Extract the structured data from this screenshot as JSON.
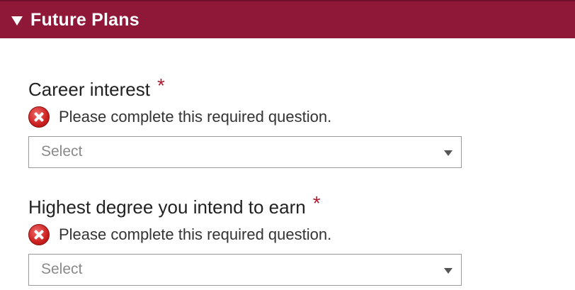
{
  "section": {
    "title": "Future Plans",
    "expanded_icon": "triangle-down-icon",
    "header_color": "#8f1838"
  },
  "questions": [
    {
      "label": "Career interest",
      "required_marker": "*",
      "error": {
        "icon": "error-x-icon",
        "message": "Please complete this required question."
      },
      "select": {
        "value": "Select",
        "icon": "caret-down-icon"
      }
    },
    {
      "label": "Highest degree you intend to earn",
      "required_marker": "*",
      "error": {
        "icon": "error-x-icon",
        "message": "Please complete this required question."
      },
      "select": {
        "value": "Select",
        "icon": "caret-down-icon"
      }
    }
  ],
  "colors": {
    "error": "#cc2020",
    "required": "#b01c2e"
  }
}
